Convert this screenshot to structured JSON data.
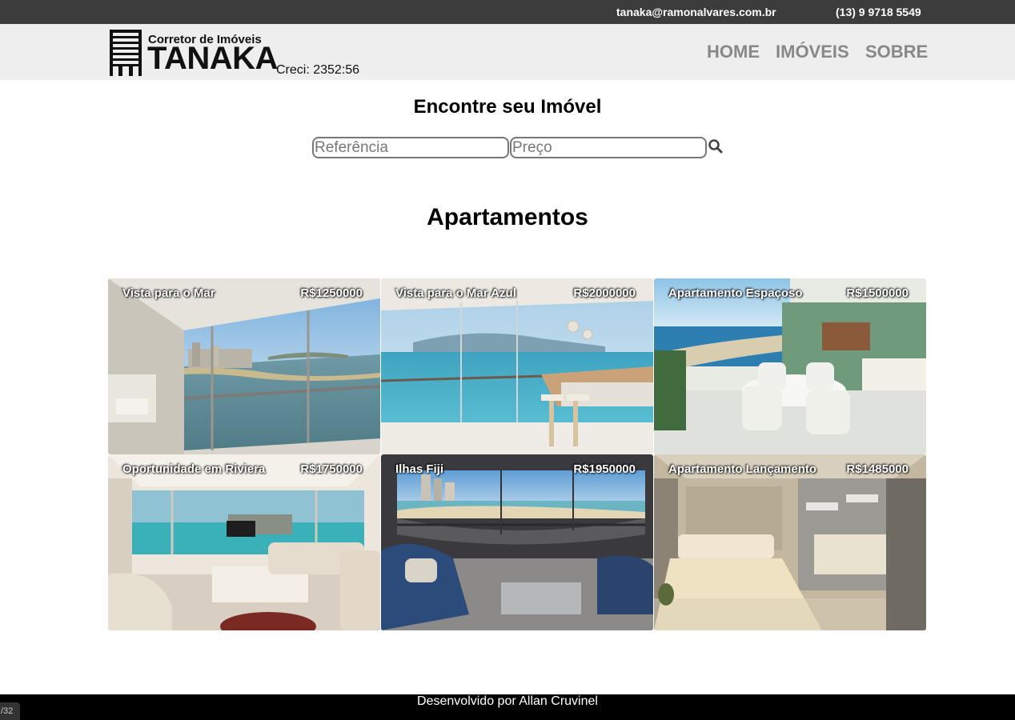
{
  "topbar": {
    "email": "tanaka@ramonalvares.com.br",
    "phone": "(13) 9 9718 5549"
  },
  "header": {
    "logo_small": "Corretor de Imóveis",
    "logo_big": "TANAKA",
    "creci": "Creci: 2352:56",
    "nav": {
      "home": "HOME",
      "imoveis": "IMÓVEIS",
      "sobre": "SOBRE"
    },
    "nav_color": "#888888"
  },
  "search": {
    "title": "Encontre seu Imóvel",
    "ref_placeholder": "Referência",
    "price_placeholder": "Preço",
    "button_icon": "search-icon"
  },
  "section_title": "Apartamentos",
  "listings": [
    {
      "title": "Vista para o Mar",
      "price": "R$1250000"
    },
    {
      "title": "Vista para o Mar Azul",
      "price": "R$2000000"
    },
    {
      "title": "Apartamento Espaçoso",
      "price": "R$1500000"
    },
    {
      "title": "Oportunidade em Riviera",
      "price": "R$1750000"
    },
    {
      "title": "Ilhas Fiji",
      "price": "R$1950000"
    },
    {
      "title": "Apartamento Lançamento",
      "price": "R$1485000"
    }
  ],
  "footer": {
    "credit": "Desenvolvido por Allan Cruvinel"
  },
  "badge": "/32"
}
